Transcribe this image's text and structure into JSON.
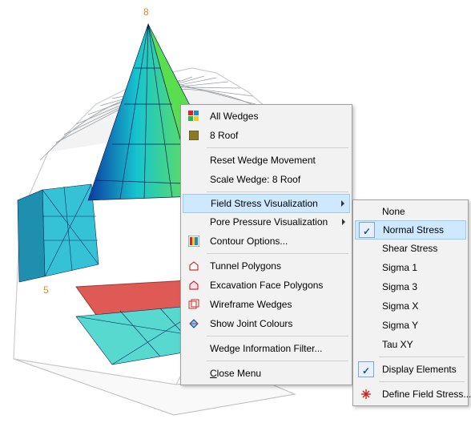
{
  "scene": {
    "node_labels": {
      "top": "8",
      "left": "5"
    }
  },
  "menu1": {
    "all_wedges": "All Wedges",
    "roof_wedge": "8  Roof",
    "reset": "Reset Wedge Movement",
    "scale": "Scale Wedge: 8  Roof",
    "field_stress": "Field Stress Visualization",
    "pore_pressure": "Pore Pressure Visualization",
    "contour": "Contour Options...",
    "tunnel_poly": "Tunnel Polygons",
    "exc_face_poly": "Excavation Face Polygons",
    "wireframe": "Wireframe Wedges",
    "joint_colours": "Show Joint Colours",
    "wedge_info": "Wedge Information Filter...",
    "close": "Close Menu"
  },
  "menu2": {
    "none": "None",
    "normal": "Normal Stress",
    "shear": "Shear Stress",
    "sigma1": "Sigma 1",
    "sigma3": "Sigma 3",
    "sigmax": "Sigma X",
    "sigmay": "Sigma Y",
    "tauxy": "Tau XY",
    "display_elements": "Display Elements",
    "define": "Define Field Stress..."
  }
}
